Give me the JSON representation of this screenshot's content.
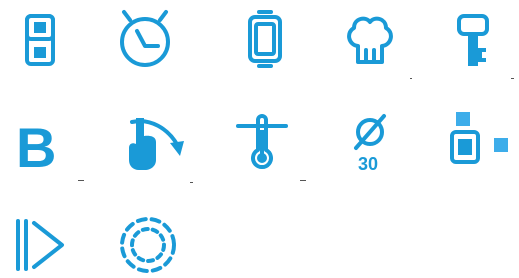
{
  "theme": {
    "accent": "#1a9ad7",
    "accent_light": "#3dadea"
  },
  "icons": [
    {
      "name": "double-square-icon"
    },
    {
      "name": "alarm-clock-icon"
    },
    {
      "name": "baking-tray-icon"
    },
    {
      "name": "chef-hat-icon"
    },
    {
      "name": "key-icon"
    },
    {
      "name": "letter-b-icon",
      "label": "B"
    },
    {
      "name": "finger-tap-arrow-icon"
    },
    {
      "name": "thermometer-icon"
    },
    {
      "name": "diameter-icon",
      "label": "30"
    },
    {
      "name": "zone-squares-icon"
    },
    {
      "name": "play-step-icon"
    },
    {
      "name": "dashed-circle-icon"
    }
  ]
}
